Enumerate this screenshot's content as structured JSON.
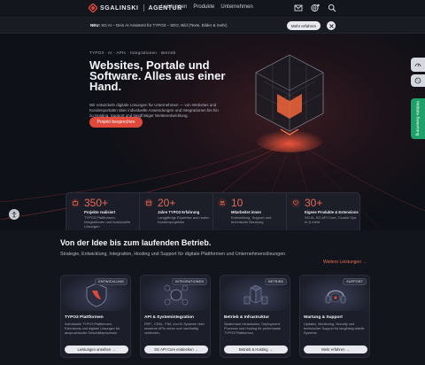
{
  "header": {
    "logo_name": "SGALINSKI",
    "logo_sub": "AGENTUR",
    "nav": [
      "Leistungen",
      "Produkte",
      "Unternehmen"
    ],
    "accent": "#e0483a"
  },
  "announcement": {
    "lead": "NEU:",
    "text": "SG AI – Dein AI Assistent für TYPO3 – SEO, Bild (Texte, Bilder & mehr)",
    "button": "Mehr erfahren"
  },
  "hero": {
    "breadcrumb": "TYPO3 · AI · APIs · Integrationen · Betrieb",
    "title": "Websites, Portale und Software. Alles aus einer Hand.",
    "description": "Wir entwickeln digitale Lösungen für Unternehmen — von Websites und Kundenportalen über individuelle Anwendungen und Integrationen bis hin zu Hosting, Support und langfristiger Weiterentwicklung.",
    "cta": "Projekt besprechen"
  },
  "stats": [
    {
      "number": "350+",
      "label": "Projekte realisiert",
      "desc": "TYPO3 Plattformen, Integrationen und individuelle Lösungen"
    },
    {
      "number": "20+",
      "label": "Jahre TYPO3 Erfahrung",
      "desc": "Langjährige Expertise aus realen Kundenprojekten"
    },
    {
      "number": "10",
      "label": "Mitarbeiter:innen",
      "desc": "Entwicklung, Support und technische Beratung"
    },
    {
      "number": "30+",
      "label": "Eigene Produkte & Extensions",
      "desc": "SG AI, SG API Core, Cookie Opt-In & mehr"
    }
  ],
  "side": {
    "tab": "Website-Bewertung"
  },
  "services": {
    "title": "Von der Idee bis zum laufenden Betrieb.",
    "description": "Strategie, Entwicklung, Integration, Hosting und Support für digitale Plattformen und Unternehmenslösungen",
    "more": "Weitere Leistungen →",
    "cards": [
      {
        "tag": "ENTWICKLUNG",
        "title": "TYPO3 Plattformen",
        "desc": "Individuelle TYPO3 Plattformen, Extensions und digitale Lösungen für anspruchsvolle Geschäftsprozesse.",
        "button": "Leistungen ansehen →"
      },
      {
        "tag": "INTEGRATIONEN",
        "title": "API & Systemintegration",
        "desc": "ERP-, CRM-, PIM- und KI-Systeme über moderne APIs sicher und nachhaltig verbinden.",
        "button": "SG API Core entdecken →"
      },
      {
        "tag": "BETRIEB",
        "title": "Betrieb & Infrastruktur",
        "desc": "Skalierbare Infrastruktur, Deployment-Prozesse und Hosting für performante TYPO3 Plattformen.",
        "button": "Betrieb & Hosting →"
      },
      {
        "tag": "SUPPORT",
        "title": "Wartung & Support",
        "desc": "Updates, Monitoring, Security und technischer Support für langfristig stabile Systeme.",
        "button": "Mehr erfahren →"
      }
    ]
  }
}
